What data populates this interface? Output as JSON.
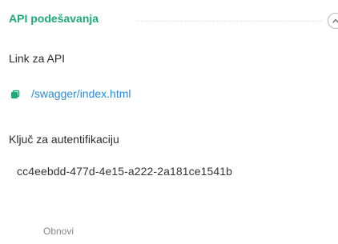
{
  "section": {
    "title": "API podešavanja",
    "collapse_icon": "chevron-up-icon"
  },
  "api": {
    "label": "Link za API",
    "link_icon": "link-icon",
    "link_text": "/swagger/index.html",
    "link_color": "#2d8bd1"
  },
  "auth": {
    "label": "Ključ za autentifikaciju",
    "key_value": "cc4eebdd-477d-4e15-a222-2a181ce1541b"
  },
  "actions": {
    "refresh_label": "Obnovi"
  },
  "colors": {
    "accent": "#1fa87c",
    "link": "#2d8bd1"
  }
}
